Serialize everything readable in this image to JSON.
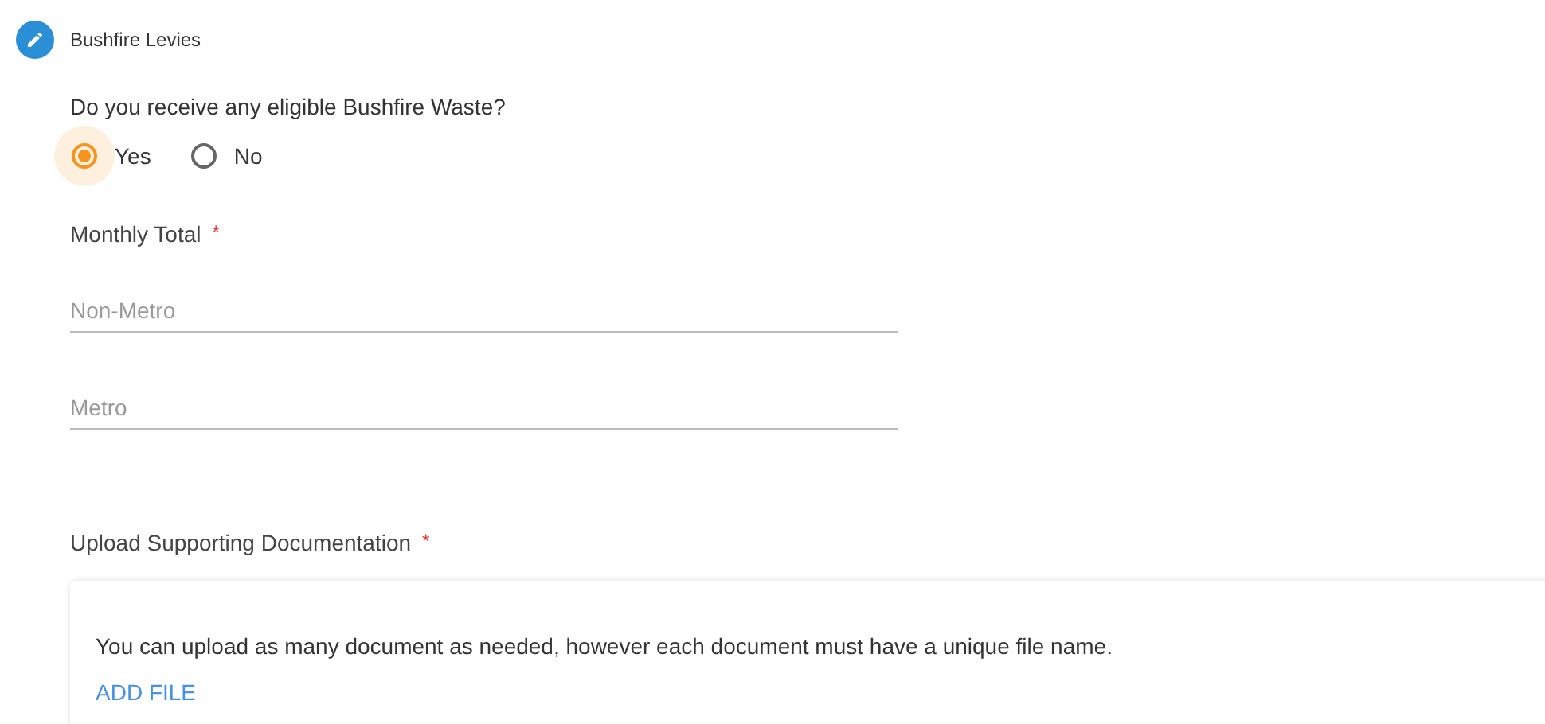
{
  "section": {
    "title": "Bushfire Levies"
  },
  "question": {
    "label": "Do you receive any eligible Bushfire Waste?",
    "options": [
      {
        "label": "Yes",
        "selected": true
      },
      {
        "label": "No",
        "selected": false
      }
    ]
  },
  "monthly_total": {
    "label": "Monthly Total",
    "required_mark": "*",
    "fields": [
      {
        "placeholder": "Non-Metro"
      },
      {
        "placeholder": "Metro"
      }
    ]
  },
  "upload": {
    "label": "Upload Supporting Documentation",
    "required_mark": "*",
    "note": "You can upload as many document as needed, however each document must have a unique file name.",
    "button": "ADD FILE"
  }
}
